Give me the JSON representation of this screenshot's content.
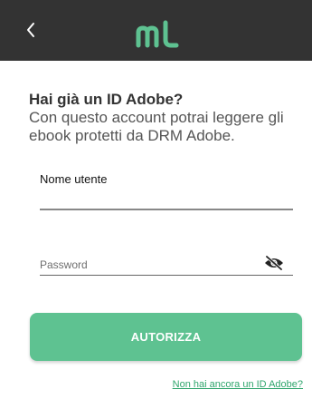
{
  "app": {
    "logo_text": "ml",
    "logo_color": "#5ec291",
    "topbar_color": "#333333",
    "back_icon": "chevron-left-icon"
  },
  "intro": {
    "heading": "Hai già un ID Adobe?",
    "description": "Con questo account potrai leggere gli ebook protetti da DRM Adobe."
  },
  "form": {
    "username_label": "Nome utente",
    "username_value": "",
    "password_placeholder": "Password",
    "password_value": "",
    "visibility_icon": "eye-off-icon"
  },
  "actions": {
    "authorize_label": "AUTORIZZA",
    "authorize_color": "#5ec291",
    "no_id_link": "Non hai ancora un ID Adobe?"
  }
}
